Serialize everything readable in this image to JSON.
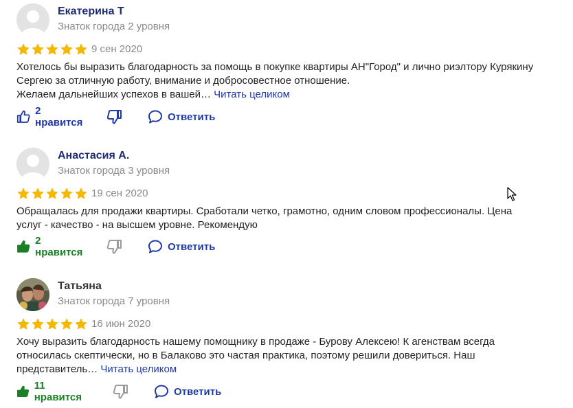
{
  "reviews": [
    {
      "author": "Екатерина Т",
      "level": "Знаток города 2 уровня",
      "date": "9 сен 2020",
      "text_lines": [
        "Хотелось бы выразить благодарность за помощь в покупке квартиры АН\"Город\" и лично риэлтору Курякину",
        "Сергею за отличную работу, внимание и добросовестное отношение.",
        "Желаем дальнейших успехов в вашей…"
      ],
      "read_more": "Читать целиком",
      "likes": "2 нравится",
      "reply": "Ответить",
      "liked": false,
      "rating": 5
    },
    {
      "author": "Анастасия А.",
      "level": "Знаток города 3 уровня",
      "date": "19 сен 2020",
      "text_lines": [
        "Обращалась для продажи квартиры. Сработали четко, грамотно, одним словом профессионалы. Цена",
        "услуг - качество - на высшем уровне. Рекомендую"
      ],
      "read_more": "",
      "likes": "2 нравится",
      "reply": "Ответить",
      "liked": true,
      "rating": 5
    },
    {
      "author": "Татьяна",
      "level": "Знаток города 7 уровня",
      "date": "16 июн 2020",
      "text_lines": [
        "Хочу выразить благодарность нашему помощнику в продаже - Бурову Алексею! К агенствам всегда",
        "относилась скептически, но в Балаково это частая практика, поэтому решили довериться. Наш",
        "представитель…"
      ],
      "read_more": "Читать целиком",
      "likes": "11 нравится",
      "reply": "Ответить",
      "liked": true,
      "rating": 5
    }
  ],
  "colors": {
    "star": "#f5b800",
    "link": "#1f3aa8",
    "liked": "#1a7f25",
    "author": "#1f2b70"
  },
  "icons": [
    "star-icon",
    "thumbs-up-icon",
    "thumbs-down-icon",
    "comment-icon",
    "mouse-cursor-icon"
  ]
}
